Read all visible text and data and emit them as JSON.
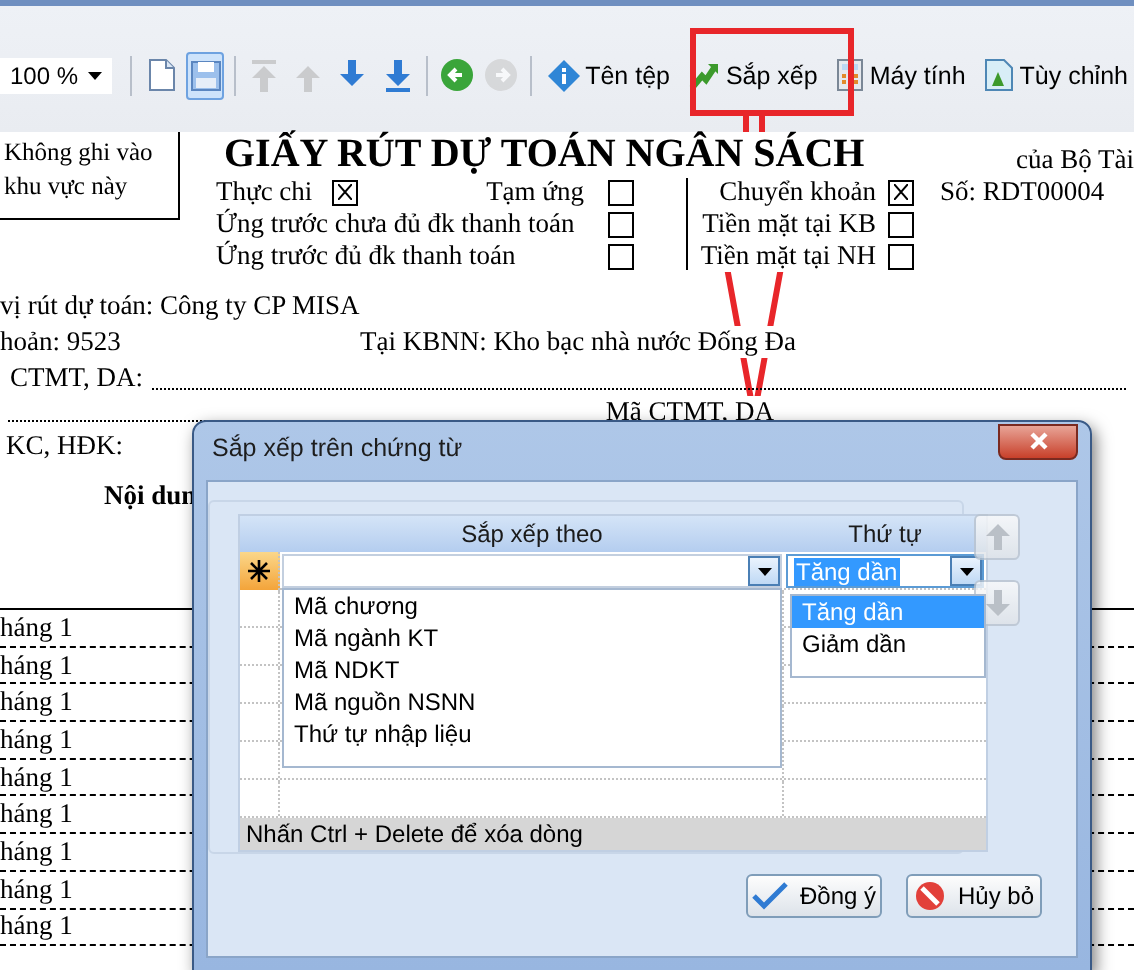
{
  "toolbar": {
    "zoom": "100 %",
    "tool_groups": [
      [
        {
          "disabled": false,
          "pressed": false
        },
        {
          "disabled": false,
          "pressed": true
        }
      ],
      [
        {
          "disabled": true,
          "pressed": false
        },
        {
          "disabled": true,
          "pressed": false
        },
        {
          "disabled": false,
          "pressed": false
        },
        {
          "disabled": false,
          "pressed": false
        }
      ],
      [
        {
          "disabled": false,
          "pressed": false
        },
        {
          "disabled": true,
          "pressed": false
        }
      ]
    ],
    "commands": [
      {
        "label": "Tên tệp"
      },
      {
        "label": "Sắp xếp"
      },
      {
        "label": "Máy tính"
      },
      {
        "label": "Tùy chỉnh"
      }
    ]
  },
  "document": {
    "stamp": "Không ghi vào khu vực này",
    "title": "GIẤY RÚT DỰ TOÁN NGÂN SÁCH",
    "issuer": "của Bộ Tài",
    "number": "Số: RDT00004",
    "payment_types": [
      {
        "label": "Thực chi",
        "checked": true
      },
      {
        "label": "Tạm ứng",
        "checked": false
      },
      {
        "label": "Ứng trước chưa đủ đk thanh toán",
        "checked": false
      },
      {
        "label": "Ứng trước đủ đk thanh toán",
        "checked": false
      }
    ],
    "payment_methods": [
      {
        "label": "Chuyển khoản",
        "checked": true
      },
      {
        "label": "Tiền mặt tại KB",
        "checked": false
      },
      {
        "label": "Tiền mặt tại NH",
        "checked": false
      }
    ],
    "unit": "vị rút dự toán: Công ty CP MISA",
    "account": "hoản: 9523",
    "treasury": "Tại KBNN: Kho bạc nhà nước Đống Đa",
    "program": "CTMT, DA:",
    "program_code": "Mã CTMT, DA",
    "contract": "KC, HĐK:",
    "table_heading": "Nội dun",
    "rows": [
      "háng 1",
      "háng 1",
      "háng 1",
      "háng 1",
      "háng 1",
      "háng 1",
      "háng 1",
      "háng 1",
      "háng 1"
    ]
  },
  "dialog": {
    "title": "Sắp xếp trên chứng từ",
    "columns": [
      "Sắp xếp theo",
      "Thứ tự"
    ],
    "new_row": {
      "order": "Tăng dần"
    },
    "field_options": [
      {
        "label": "Mã chương",
        "selected": false
      },
      {
        "label": "Mã ngành KT",
        "selected": false
      },
      {
        "label": "Mã NDKT",
        "selected": false
      },
      {
        "label": "Mã nguồn NSNN",
        "selected": false
      },
      {
        "label": "Thứ tự nhập liệu",
        "selected": false
      }
    ],
    "order_options": [
      {
        "label": "Tăng dần",
        "selected": true
      },
      {
        "label": "Giảm dần",
        "selected": false
      }
    ],
    "move_buttons": [
      {
        "disabled": true
      },
      {
        "disabled": true
      }
    ],
    "hint": "Nhấn Ctrl + Delete để xóa dòng",
    "buttons": [
      {
        "label": "Đồng ý"
      },
      {
        "label": "Hủy bỏ"
      }
    ]
  }
}
